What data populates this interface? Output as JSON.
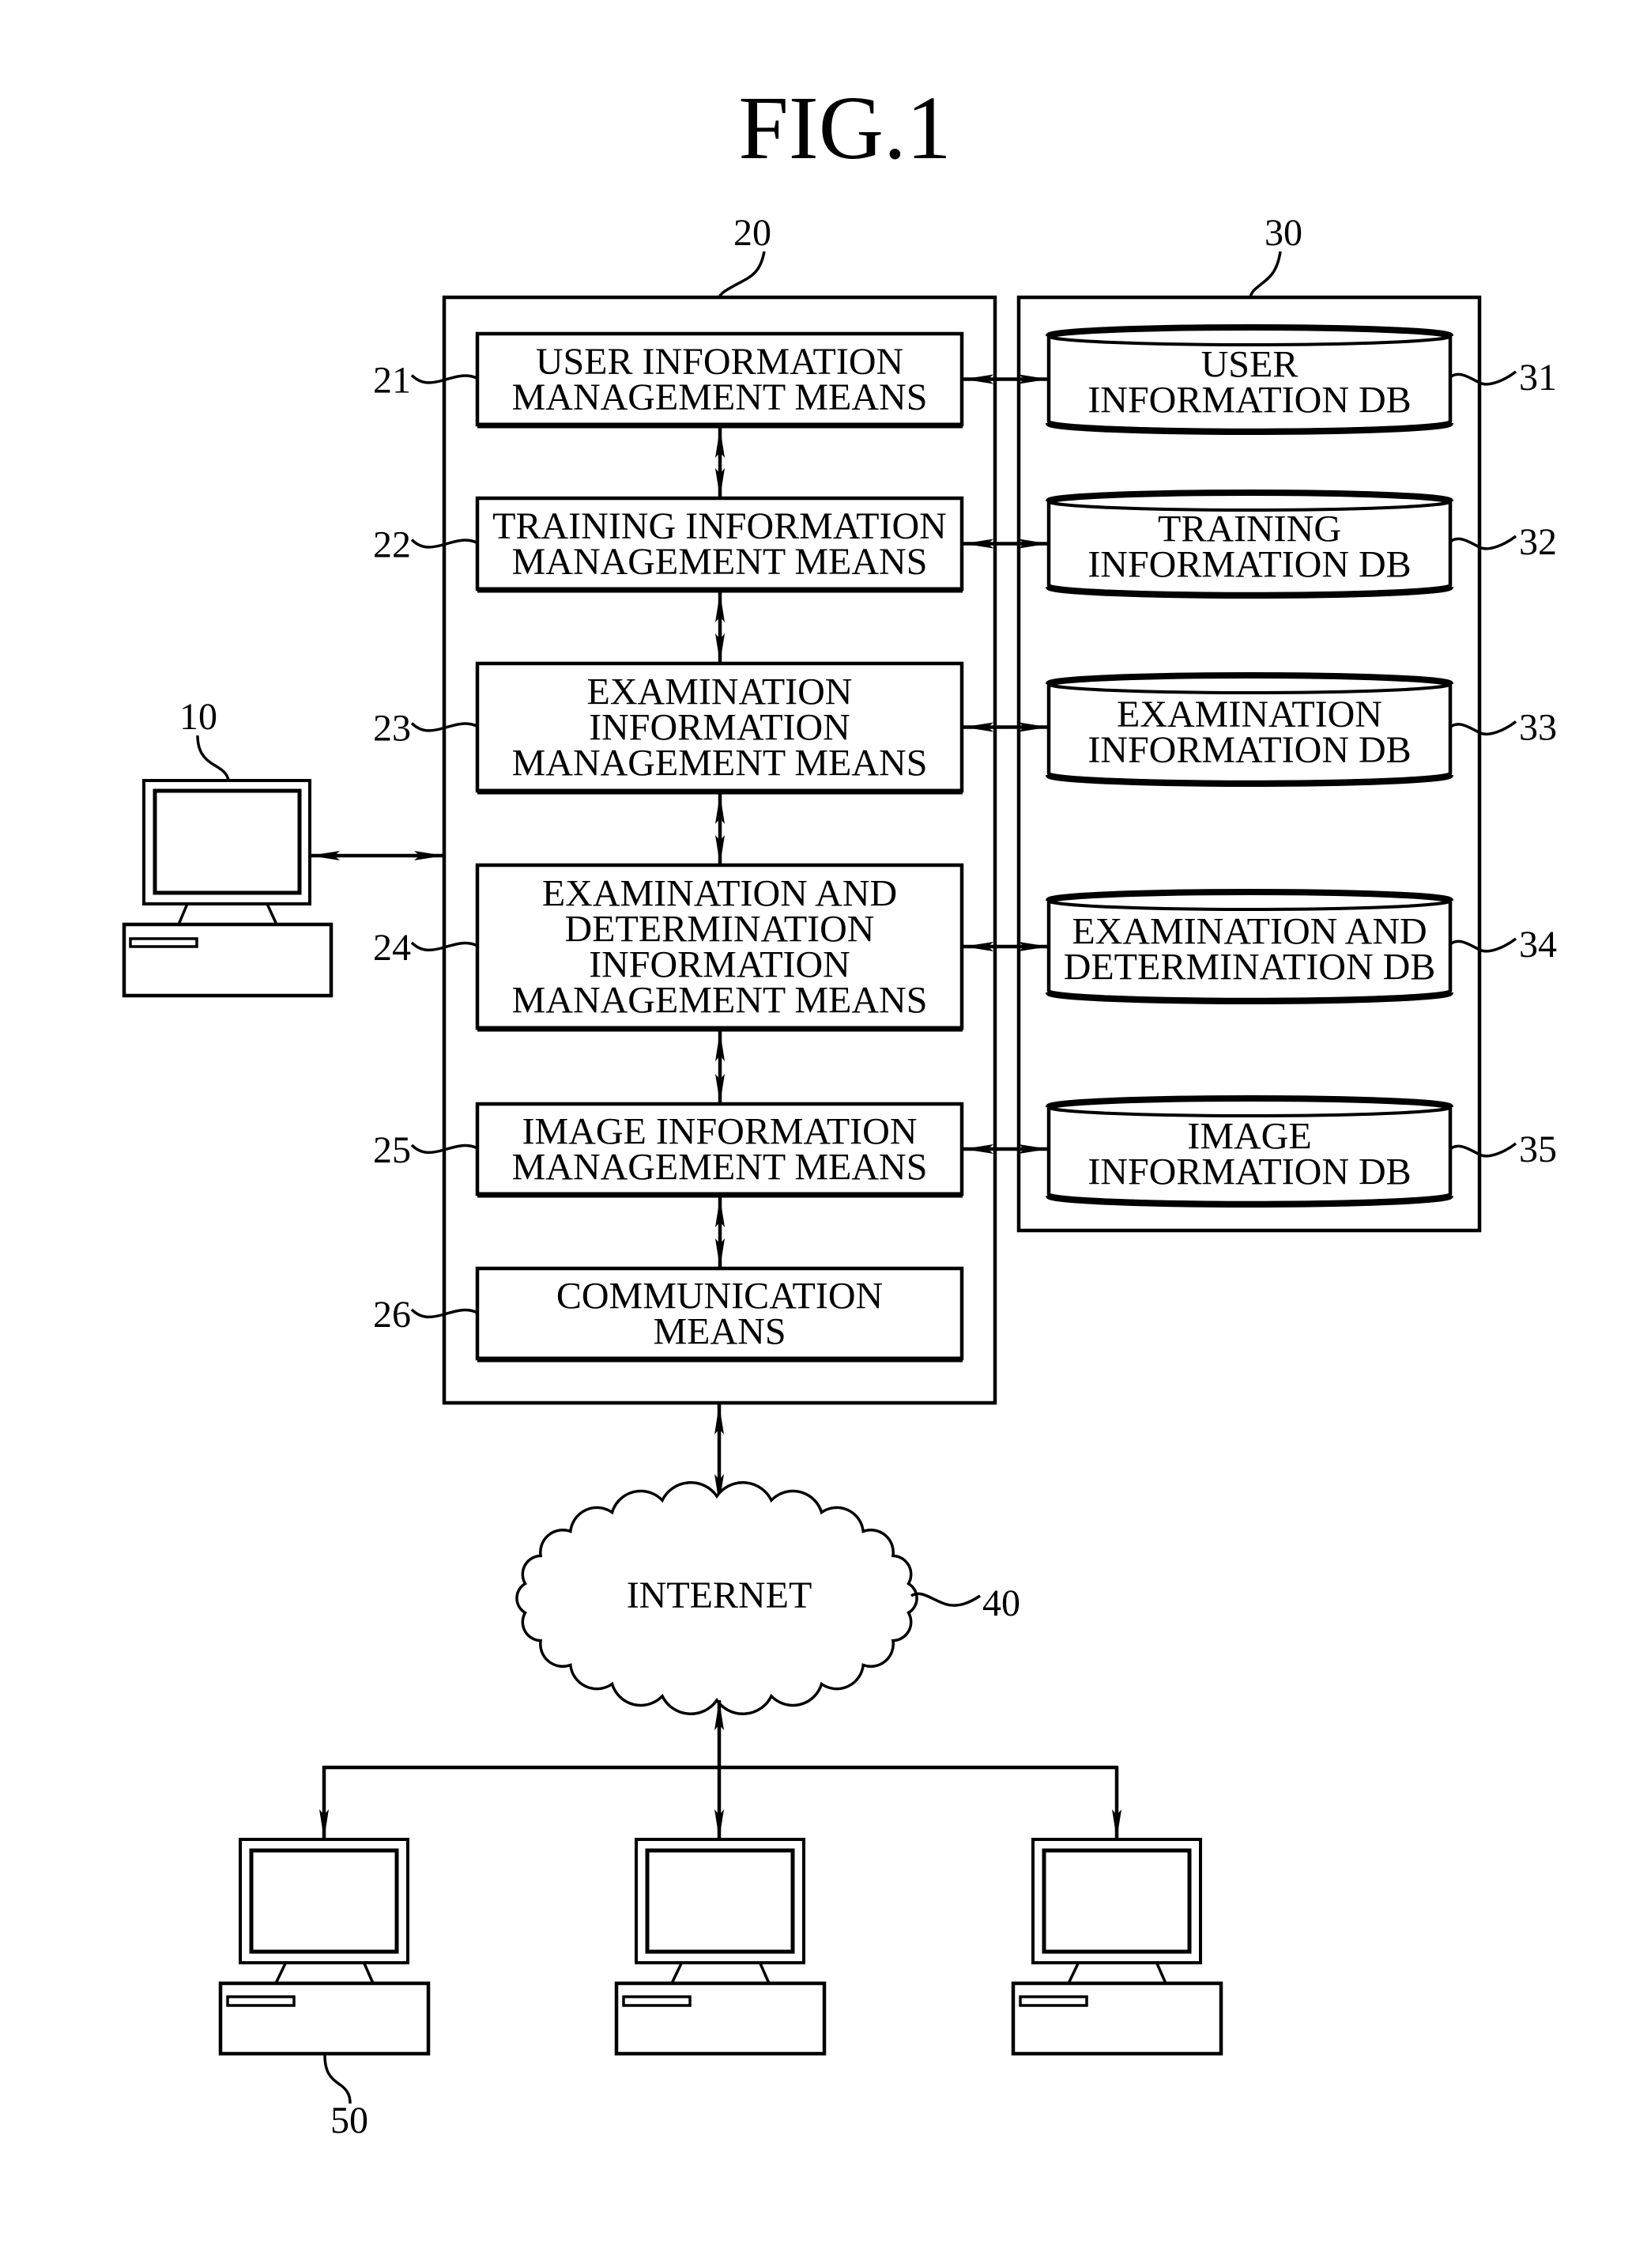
{
  "figure": {
    "title": "FIG.1"
  },
  "server": {
    "ref": "20",
    "modules": [
      {
        "ref": "21",
        "lines": [
          "USER INFORMATION",
          "MANAGEMENT MEANS"
        ]
      },
      {
        "ref": "22",
        "lines": [
          "TRAINING INFORMATION",
          "MANAGEMENT MEANS"
        ]
      },
      {
        "ref": "23",
        "lines": [
          "EXAMINATION",
          "INFORMATION",
          "MANAGEMENT MEANS"
        ]
      },
      {
        "ref": "24",
        "lines": [
          "EXAMINATION AND",
          "DETERMINATION",
          "INFORMATION",
          "MANAGEMENT MEANS"
        ]
      },
      {
        "ref": "25",
        "lines": [
          "IMAGE INFORMATION",
          "MANAGEMENT MEANS"
        ]
      },
      {
        "ref": "26",
        "lines": [
          "COMMUNICATION",
          "MEANS"
        ]
      }
    ]
  },
  "database": {
    "ref": "30",
    "dbs": [
      {
        "ref": "31",
        "lines": [
          "USER",
          "INFORMATION DB"
        ]
      },
      {
        "ref": "32",
        "lines": [
          "TRAINING",
          "INFORMATION DB"
        ]
      },
      {
        "ref": "33",
        "lines": [
          "EXAMINATION",
          "INFORMATION DB"
        ]
      },
      {
        "ref": "34",
        "lines": [
          "EXAMINATION AND",
          "DETERMINATION DB"
        ]
      },
      {
        "ref": "35",
        "lines": [
          "IMAGE",
          "INFORMATION DB"
        ]
      }
    ]
  },
  "admin_terminal": {
    "ref": "10",
    "icon": "computer-icon"
  },
  "network": {
    "ref": "40",
    "label": "INTERNET",
    "icon": "cloud-icon"
  },
  "user_terminals": {
    "ref": "50",
    "count": 3,
    "icon": "computer-icon"
  }
}
